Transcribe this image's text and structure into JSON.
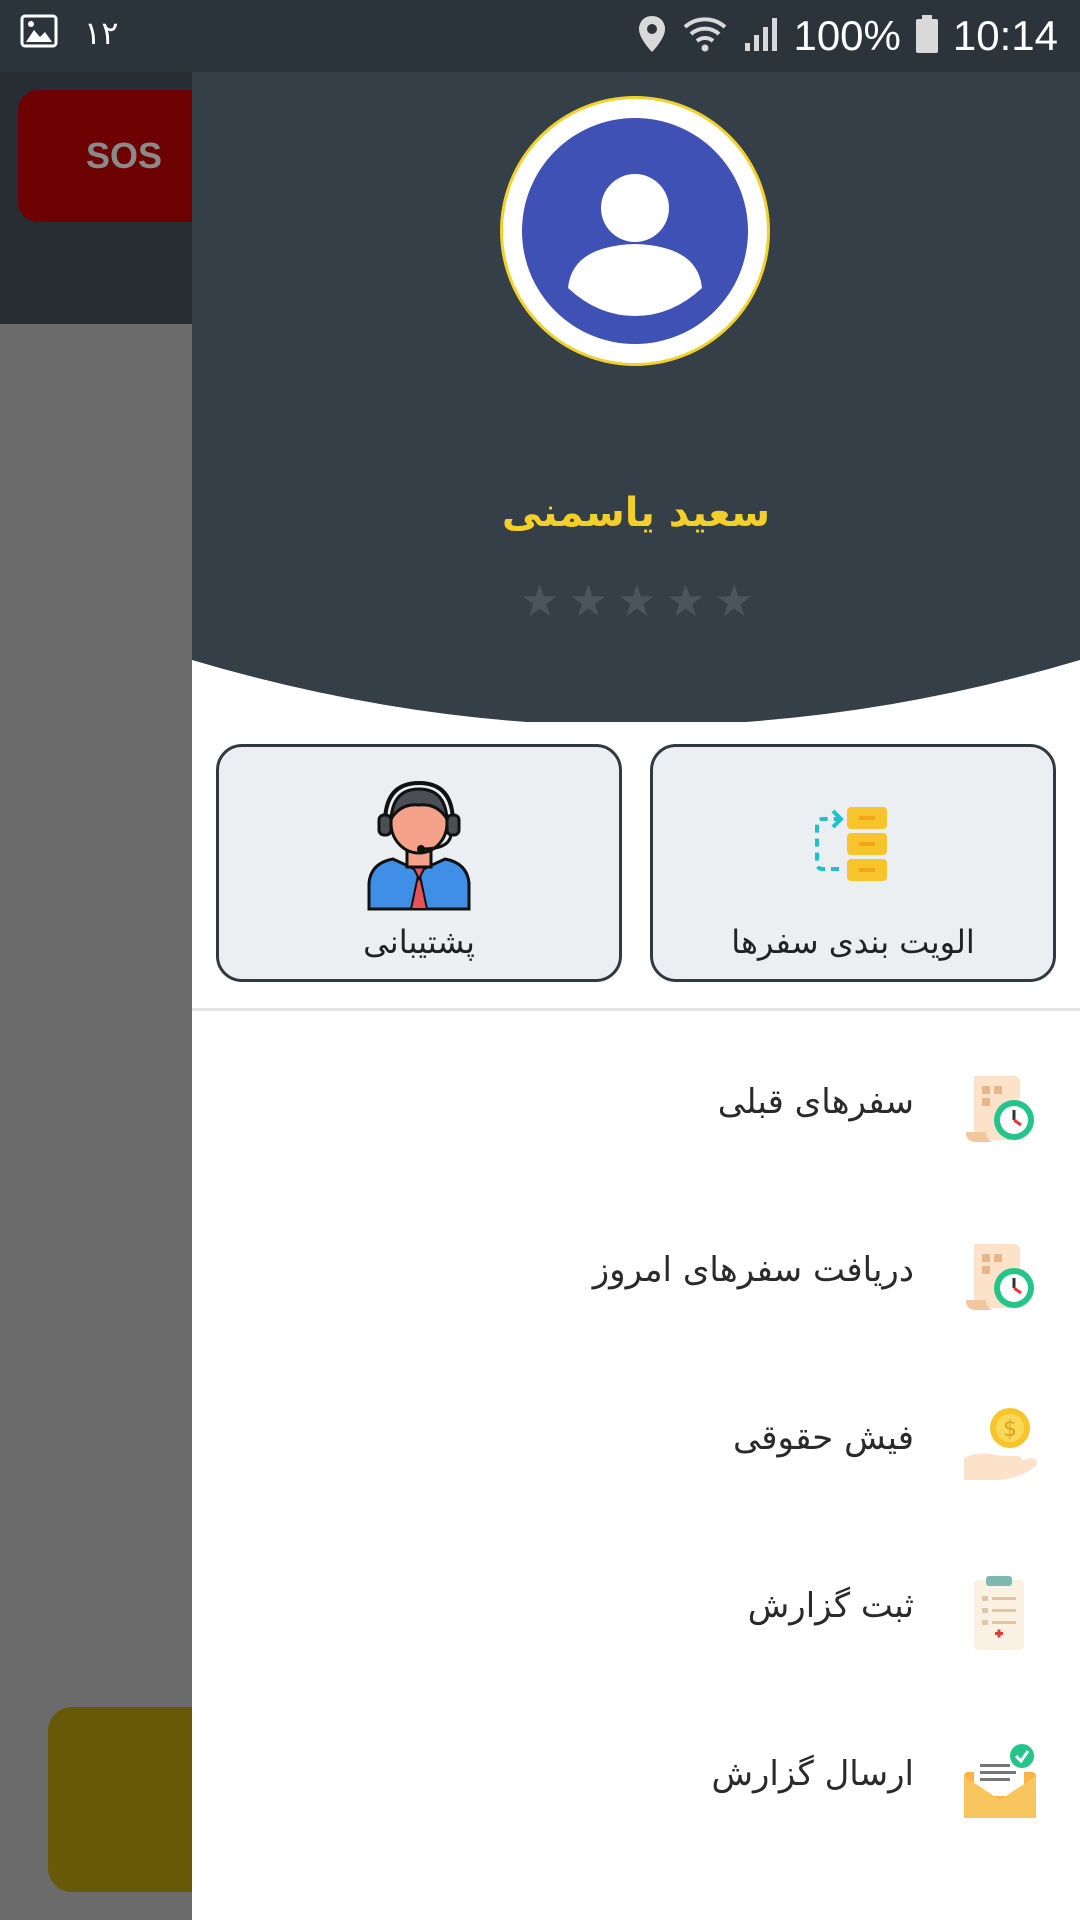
{
  "status_bar": {
    "notification_count": "۱۲",
    "battery": "100%",
    "time": "10:14",
    "icons": [
      "image-icon",
      "location-icon",
      "wifi-icon",
      "signal-icon",
      "battery-icon"
    ]
  },
  "background_app": {
    "sos_label": "SOS"
  },
  "drawer": {
    "user": {
      "name": "سعید یاسمنی",
      "rating": 0,
      "max_rating": 5
    },
    "quick_actions": [
      {
        "label": "الویت بندی سفرها",
        "icon": "reorder-icon"
      },
      {
        "label": "پشتیبانی",
        "icon": "support-agent-icon"
      }
    ],
    "menu": [
      {
        "label": "سفرهای قبلی",
        "icon": "history-receipt-icon"
      },
      {
        "label": "دریافت سفرهای امروز",
        "icon": "history-receipt-icon"
      },
      {
        "label": "فیش حقوقی",
        "icon": "salary-coin-icon"
      },
      {
        "label": "ثبت گزارش",
        "icon": "clipboard-report-icon"
      },
      {
        "label": "ارسال گزارش",
        "icon": "mail-send-icon"
      }
    ]
  },
  "colors": {
    "drawer_header": "#343f47",
    "accent_yellow": "#f4cf2a",
    "avatar_blue": "#3f51b5"
  }
}
